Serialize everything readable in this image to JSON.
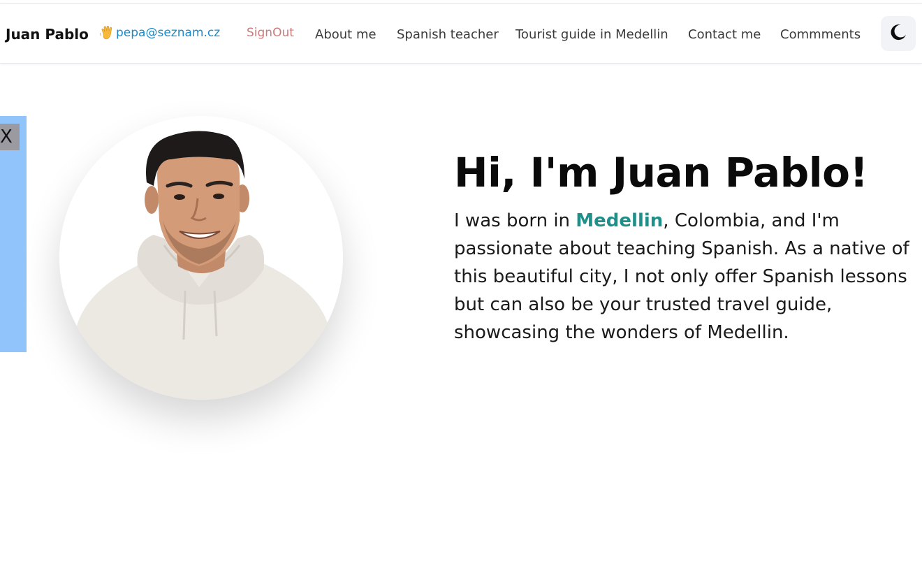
{
  "nav": {
    "brand": "Juan Pablo",
    "user_email": "pepa@seznam.cz",
    "signout_label": "SignOut",
    "links": [
      "About me",
      "Spanish teacher",
      "Tourist guide in Medellin",
      "Contact me",
      "Commments"
    ],
    "theme_icon": "moon-icon"
  },
  "side_panel": {
    "close_label": "X"
  },
  "hero": {
    "title": "Hi, I'm Juan Pablo!",
    "text_before": "I was born in ",
    "city": "Medellin",
    "text_after": ", Colombia, and I'm passionate about teaching Spanish. As a native of this beautiful city, I not only offer Spanish lessons but can also be your trusted travel guide, showcasing the wonders of Medellin."
  },
  "colors": {
    "link": "#1d8ac9",
    "signout": "#cd7a7a",
    "accent_city": "#1f8f8a",
    "side_panel": "#90c4fb"
  }
}
